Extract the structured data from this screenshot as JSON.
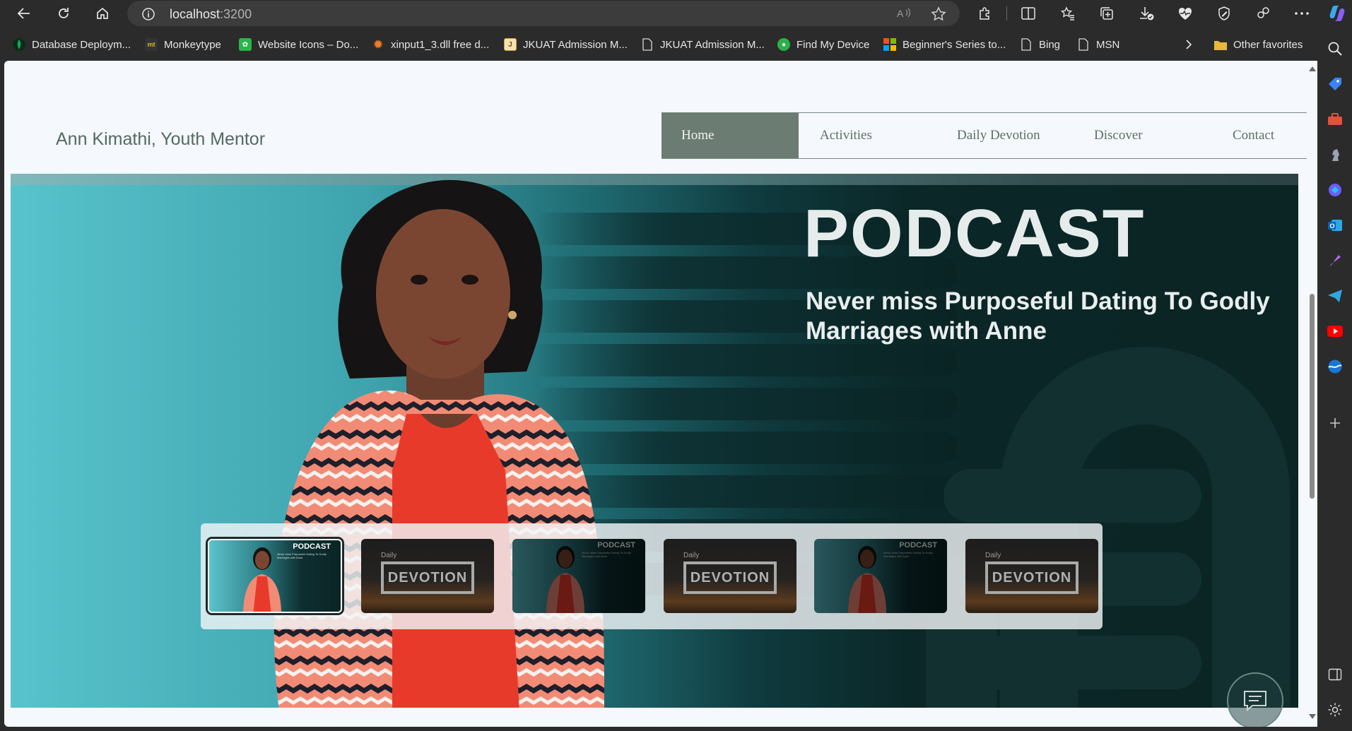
{
  "browser": {
    "url_host": "localhost",
    "url_port": ":3200",
    "favorites": [
      {
        "label": "Database Deploym...",
        "icon": "mongodb-icon",
        "color": "#13aa52"
      },
      {
        "label": "Monkeytype",
        "icon": "monkeytype-icon",
        "color": "#e2b714"
      },
      {
        "label": "Website Icons – Do...",
        "icon": "website-icons-icon",
        "color": "#29b64a"
      },
      {
        "label": "xinput1_3.dll free d...",
        "icon": "gear-orange-icon",
        "color": "#f07b24"
      },
      {
        "label": "JKUAT Admission M...",
        "icon": "jkuat-icon",
        "color": "#d9a12c"
      },
      {
        "label": "JKUAT Admission M...",
        "icon": "page-icon",
        "color": "#cccccc"
      },
      {
        "label": "Find My Device",
        "icon": "find-device-icon",
        "color": "#2bb04c"
      },
      {
        "label": "Beginner's Series to...",
        "icon": "microsoft-icon",
        "color": "#f25022"
      },
      {
        "label": "Bing",
        "icon": "page-icon",
        "color": "#cccccc"
      },
      {
        "label": "MSN",
        "icon": "page-icon",
        "color": "#cccccc"
      }
    ],
    "other_favorites": "Other favorites"
  },
  "site": {
    "brand": "Ann Kimathi, Youth Mentor",
    "nav": [
      "Home",
      "Activities",
      "Daily Devotion",
      "Discover",
      "Contact"
    ],
    "active_nav": "Home"
  },
  "hero": {
    "title": "PODCAST",
    "subtitle": "Never miss Purposeful Dating To Godly Marriages with Anne"
  },
  "thumbnails": [
    {
      "type": "podcast",
      "title": "PODCAST",
      "sub": "Never miss Purposeful Dating To Godly Marriages with Anne",
      "selected": true
    },
    {
      "type": "devotion",
      "small": "Daily",
      "big": "DEVOTION",
      "selected": false
    },
    {
      "type": "podcast",
      "title": "PODCAST",
      "sub": "Never miss Purposeful Dating To Godly Marriages with Anne",
      "selected": false
    },
    {
      "type": "devotion",
      "small": "Daily",
      "big": "DEVOTION",
      "selected": false
    },
    {
      "type": "podcast",
      "title": "PODCAST",
      "sub": "Never miss Purposeful Dating To Godly Marriages with Anne",
      "selected": false
    },
    {
      "type": "devotion",
      "small": "Daily",
      "big": "DEVOTION",
      "selected": false
    }
  ]
}
